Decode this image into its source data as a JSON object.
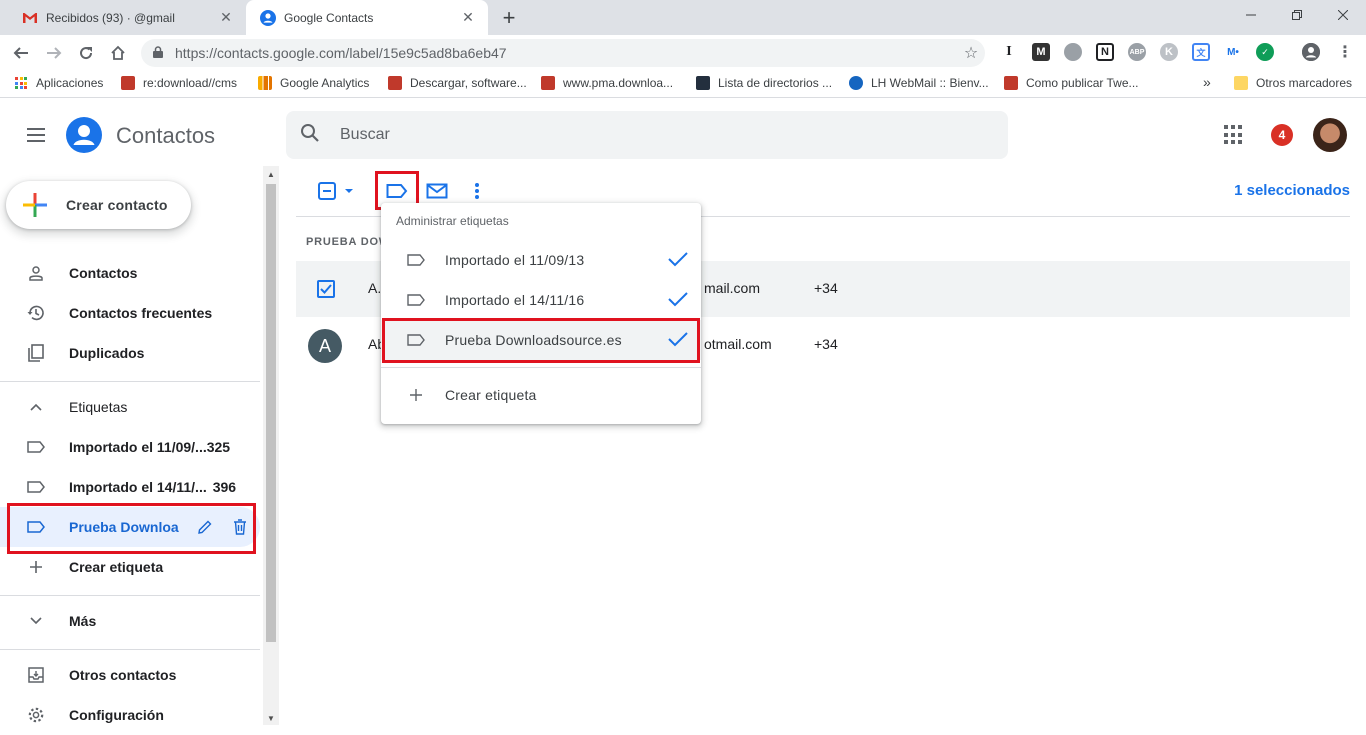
{
  "browser": {
    "tabs": [
      {
        "title": "Recibidos (93) ·                @gmail",
        "icon": "gmail-icon",
        "active": false
      },
      {
        "title": "Google Contacts",
        "icon": "contacts-icon",
        "active": true
      }
    ],
    "url": "https://contacts.google.com/label/15e9c5ad8ba6eb47",
    "bookmarks": [
      {
        "label": "Aplicaciones",
        "icon": "apps-grid-icon"
      },
      {
        "label": "re:download//cms",
        "icon": "download-site-icon"
      },
      {
        "label": "Google Analytics",
        "icon": "analytics-icon"
      },
      {
        "label": "Descargar, software...",
        "icon": "download-site-icon"
      },
      {
        "label": "www.pma.downloa...",
        "icon": "download-site-icon"
      },
      {
        "label": "Lista de directorios ...",
        "icon": "amazon-icon"
      },
      {
        "label": "LH WebMail :: Bienv...",
        "icon": "webmail-icon"
      },
      {
        "label": "Como publicar Twe...",
        "icon": "download-site-icon"
      }
    ],
    "bookmarks_overflow": "»",
    "other_bookmarks": "Otros marcadores"
  },
  "app": {
    "name": "Contactos",
    "search_placeholder": "Buscar",
    "notification_count": "4"
  },
  "sidebar": {
    "create_contact": "Crear contacto",
    "main_items": [
      {
        "label": "Contactos",
        "icon": "person-icon"
      },
      {
        "label": "Contactos frecuentes",
        "icon": "history-icon"
      },
      {
        "label": "Duplicados",
        "icon": "duplicate-icon"
      }
    ],
    "labels_header": "Etiquetas",
    "labels": [
      {
        "label": "Importado el 11/09/...",
        "count": "325"
      },
      {
        "label": "Importado el 14/11/...",
        "count": "396"
      },
      {
        "label": "Prueba Downloa",
        "count": ""
      }
    ],
    "create_label": "Crear etiqueta",
    "more": "Más",
    "other_contacts": "Otros contactos",
    "settings": "Configuración"
  },
  "main": {
    "selected_count": "1 seleccionados",
    "group_header": "PRUEBA DOW",
    "rows": [
      {
        "initial": "",
        "name": "A.",
        "email": "mail.com",
        "phone": "+34",
        "selected": true
      },
      {
        "initial": "A",
        "name": "Ab",
        "email": "otmail.com",
        "phone": "+34",
        "selected": false
      }
    ]
  },
  "label_menu": {
    "title": "Administrar etiquetas",
    "items": [
      {
        "label": "Importado el 11/09/13",
        "checked": true
      },
      {
        "label": "Importado el 14/11/16",
        "checked": true
      },
      {
        "label": "Prueba Downloadsource.es",
        "checked": true
      }
    ],
    "create_label": "Crear etiqueta"
  },
  "colors": {
    "accent": "#1a73e8",
    "highlight": "#e0121f"
  }
}
